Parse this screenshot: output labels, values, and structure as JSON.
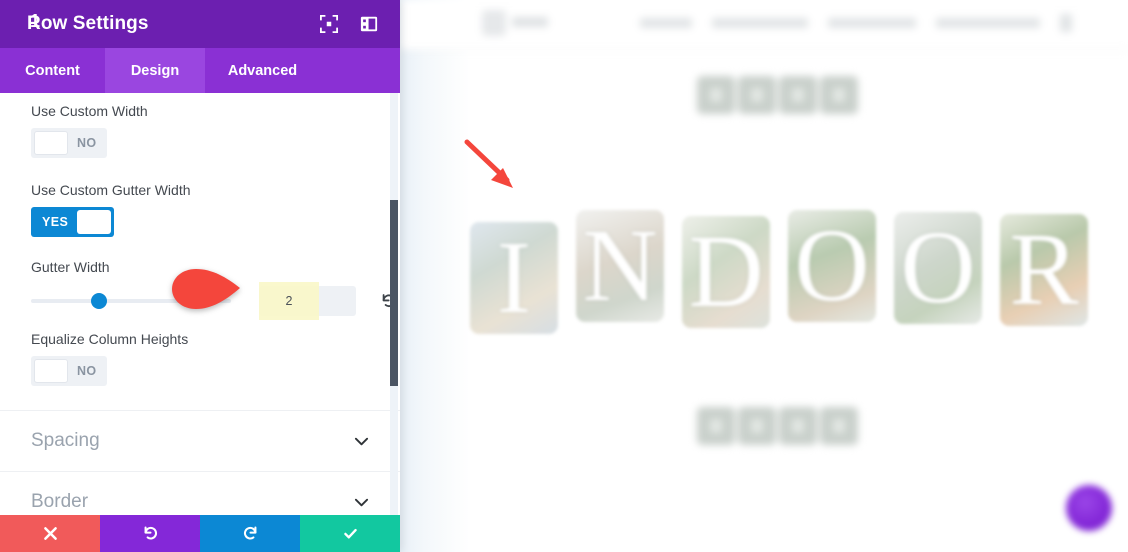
{
  "panel": {
    "title": "Row Settings",
    "header_icons": [
      {
        "name": "focus-frame-icon"
      },
      {
        "name": "panel-layout-icon"
      }
    ],
    "tabs": [
      {
        "label": "Content",
        "active": false
      },
      {
        "label": "Design",
        "active": true
      },
      {
        "label": "Advanced",
        "active": false
      }
    ],
    "fields": [
      {
        "label": "Use Custom Width",
        "type": "toggle",
        "value": "NO",
        "state": "off"
      },
      {
        "label": "Use Custom Gutter Width",
        "type": "toggle",
        "value": "YES",
        "state": "on"
      },
      {
        "label": "Gutter Width",
        "type": "range",
        "value": "2",
        "slider_percent": 32
      },
      {
        "label": "Equalize Column Heights",
        "type": "toggle",
        "value": "NO",
        "state": "off"
      }
    ],
    "labels": {
      "use_custom_width": "Use Custom Width",
      "toggle_no": "NO",
      "use_custom_gutter_width": "Use Custom Gutter Width",
      "toggle_yes": "YES",
      "gutter_width": "Gutter Width",
      "gutter_value": "2",
      "equalize_column_heights": "Equalize Column Heights",
      "toggle_no_2": "NO"
    },
    "accordions": [
      {
        "label": "Spacing",
        "expanded": false
      },
      {
        "label": "Border",
        "expanded": false
      }
    ],
    "footer_buttons": [
      {
        "name": "cancel-button",
        "icon": "x-icon",
        "color": "#f15a5a"
      },
      {
        "name": "undo-button",
        "icon": "undo-icon",
        "color": "#8428d8"
      },
      {
        "name": "redo-button",
        "icon": "redo-icon",
        "color": "#0c88d4"
      },
      {
        "name": "save-button",
        "icon": "check-icon",
        "color": "#12c8a0"
      }
    ],
    "colors": {
      "header": "#6c1fb0",
      "tabbar": "#8a30d4",
      "tab_active": "#9a46e0",
      "toggle_on": "#0c88d4",
      "slider": "#0c88d4",
      "highlight": "#faf7c8"
    }
  },
  "annotation": {
    "badge_number": "1",
    "badge_color": "#f4463c",
    "arrow_color": "#f4463c"
  },
  "preview": {
    "site_nav": [
      {
        "label": ""
      },
      {
        "label": ""
      },
      {
        "label": ""
      },
      {
        "label": ""
      }
    ],
    "letters": [
      "I",
      "N",
      "D",
      "O",
      "O",
      "R"
    ],
    "social_icons_top": [
      "icon-1",
      "icon-2",
      "icon-3",
      "icon-4"
    ],
    "social_icons_bottom": [
      "icon-1",
      "icon-2",
      "icon-3",
      "icon-4"
    ],
    "floating_button": "divi-fab-icon"
  }
}
